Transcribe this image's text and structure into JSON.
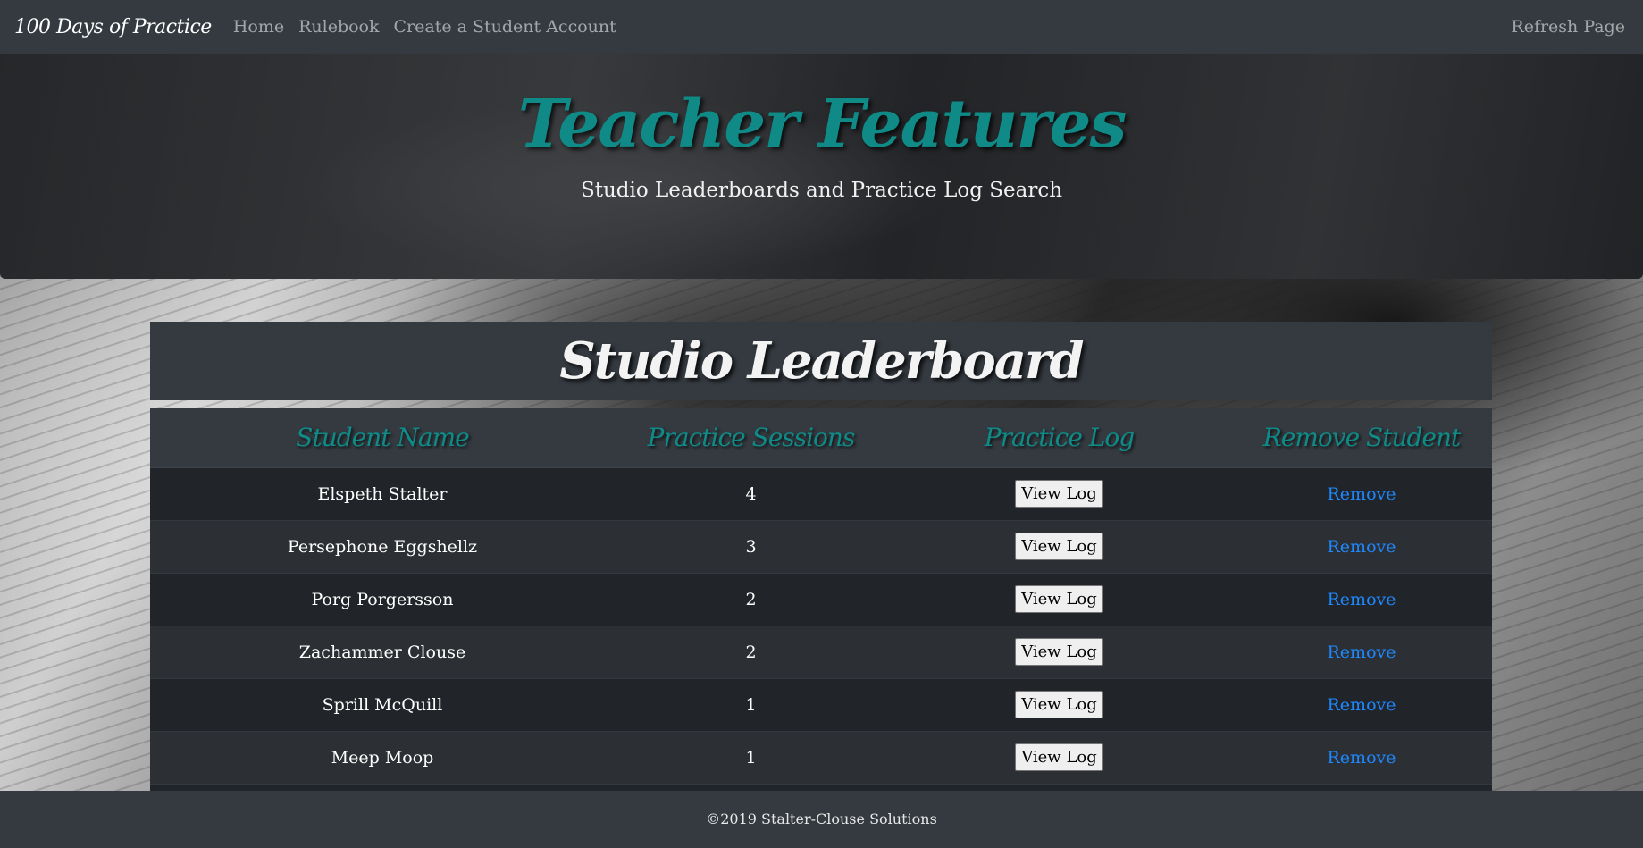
{
  "nav": {
    "brand": "100 Days of Practice",
    "links": [
      "Home",
      "Rulebook",
      "Create a Student Account"
    ],
    "refresh": "Refresh Page"
  },
  "hero": {
    "title": "Teacher Features",
    "subtitle": "Studio Leaderboards and Practice Log Search"
  },
  "leaderboard": {
    "title": "Studio Leaderboard",
    "headers": [
      "Student Name",
      "Practice Sessions",
      "Practice Log",
      "Remove Student"
    ],
    "view_label": "View Log",
    "remove_label": "Remove",
    "rows": [
      {
        "name": "Elspeth Stalter",
        "sessions": "4"
      },
      {
        "name": "Persephone Eggshellz",
        "sessions": "3"
      },
      {
        "name": "Porg Porgersson",
        "sessions": "2"
      },
      {
        "name": "Zachammer Clouse",
        "sessions": "2"
      },
      {
        "name": "Sprill McQuill",
        "sessions": "1"
      },
      {
        "name": "Meep Moop",
        "sessions": "1"
      },
      {
        "name": "",
        "sessions": ""
      }
    ]
  },
  "footer": {
    "text": "©2019 Stalter-Clouse Solutions"
  },
  "colors": {
    "navbar": "#343a40",
    "accent_teal": "#0f8a86",
    "link_blue": "#1e88ff",
    "row_dark": "#212529",
    "row_light": "#2c3034"
  }
}
